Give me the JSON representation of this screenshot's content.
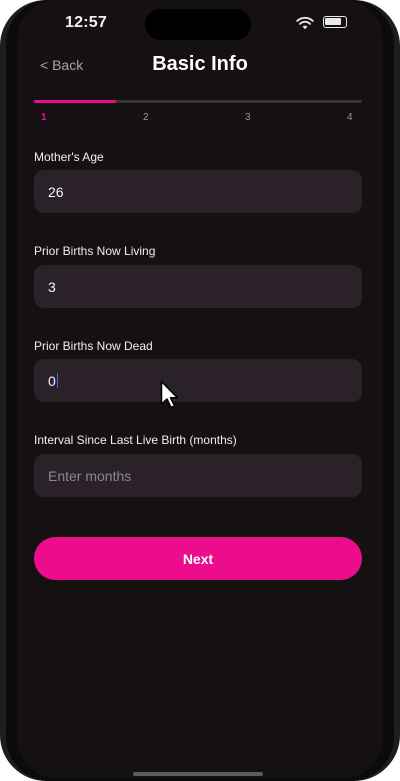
{
  "status_bar": {
    "time": "12:57"
  },
  "header": {
    "back_label": "< Back",
    "title": "Basic Info"
  },
  "progress": {
    "current_step": 1,
    "total_steps": 4,
    "fraction": 0.25,
    "steps": [
      "1",
      "2",
      "3",
      "4"
    ],
    "accent_color": "#ec0c8c"
  },
  "form": {
    "mothers_age": {
      "label": "Mother's Age",
      "value": "26"
    },
    "prior_births_living": {
      "label": "Prior Births Now Living",
      "value": "3"
    },
    "prior_births_dead": {
      "label": "Prior Births Now Dead",
      "value": "0"
    },
    "interval_since_last_birth": {
      "label": "Interval Since Last Live Birth (months)",
      "placeholder": "Enter months"
    }
  },
  "actions": {
    "next_label": "Next"
  }
}
